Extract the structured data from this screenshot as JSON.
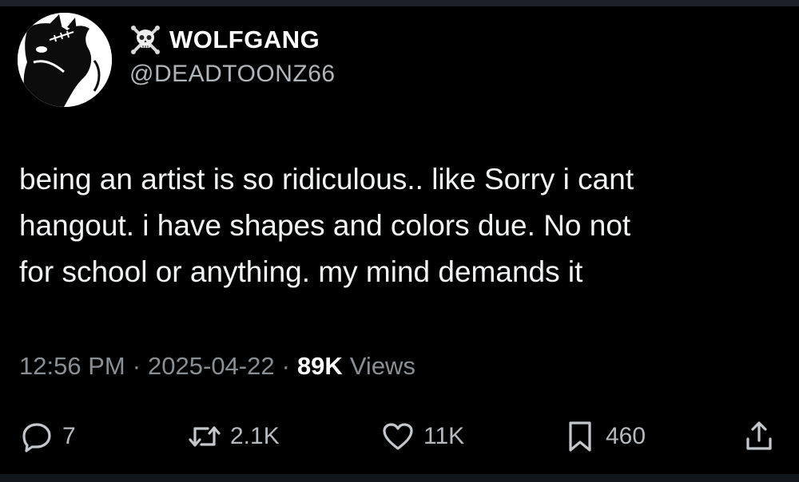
{
  "author": {
    "display_name": "WOLFGANG",
    "handle": "@DEADTOONZ66",
    "name_emoji_icon": "skull-crossbones-icon",
    "avatar_icon": "wolf-cartoon-avatar"
  },
  "tweet": {
    "lines": [
      "being an artist is so ridiculous.. like Sorry i cant",
      "hangout. i have shapes and colors due. No not",
      "for school or anything. my mind demands it"
    ]
  },
  "meta": {
    "time": "12:56 PM",
    "separator": "·",
    "date": "2025-04-22",
    "views_count": "89K",
    "views_label": "Views"
  },
  "actions": {
    "replies": {
      "icon": "reply-icon",
      "count": "7"
    },
    "retweets": {
      "icon": "retweet-icon",
      "count": "2.1K"
    },
    "likes": {
      "icon": "heart-icon",
      "count": "11K"
    },
    "bookmarks": {
      "icon": "bookmark-icon",
      "count": "460"
    },
    "share": {
      "icon": "share-icon"
    }
  },
  "colors": {
    "background": "#000000",
    "primary_text": "#f2f4f5",
    "secondary_text": "#8a8f94",
    "action_text": "#b6babe"
  }
}
